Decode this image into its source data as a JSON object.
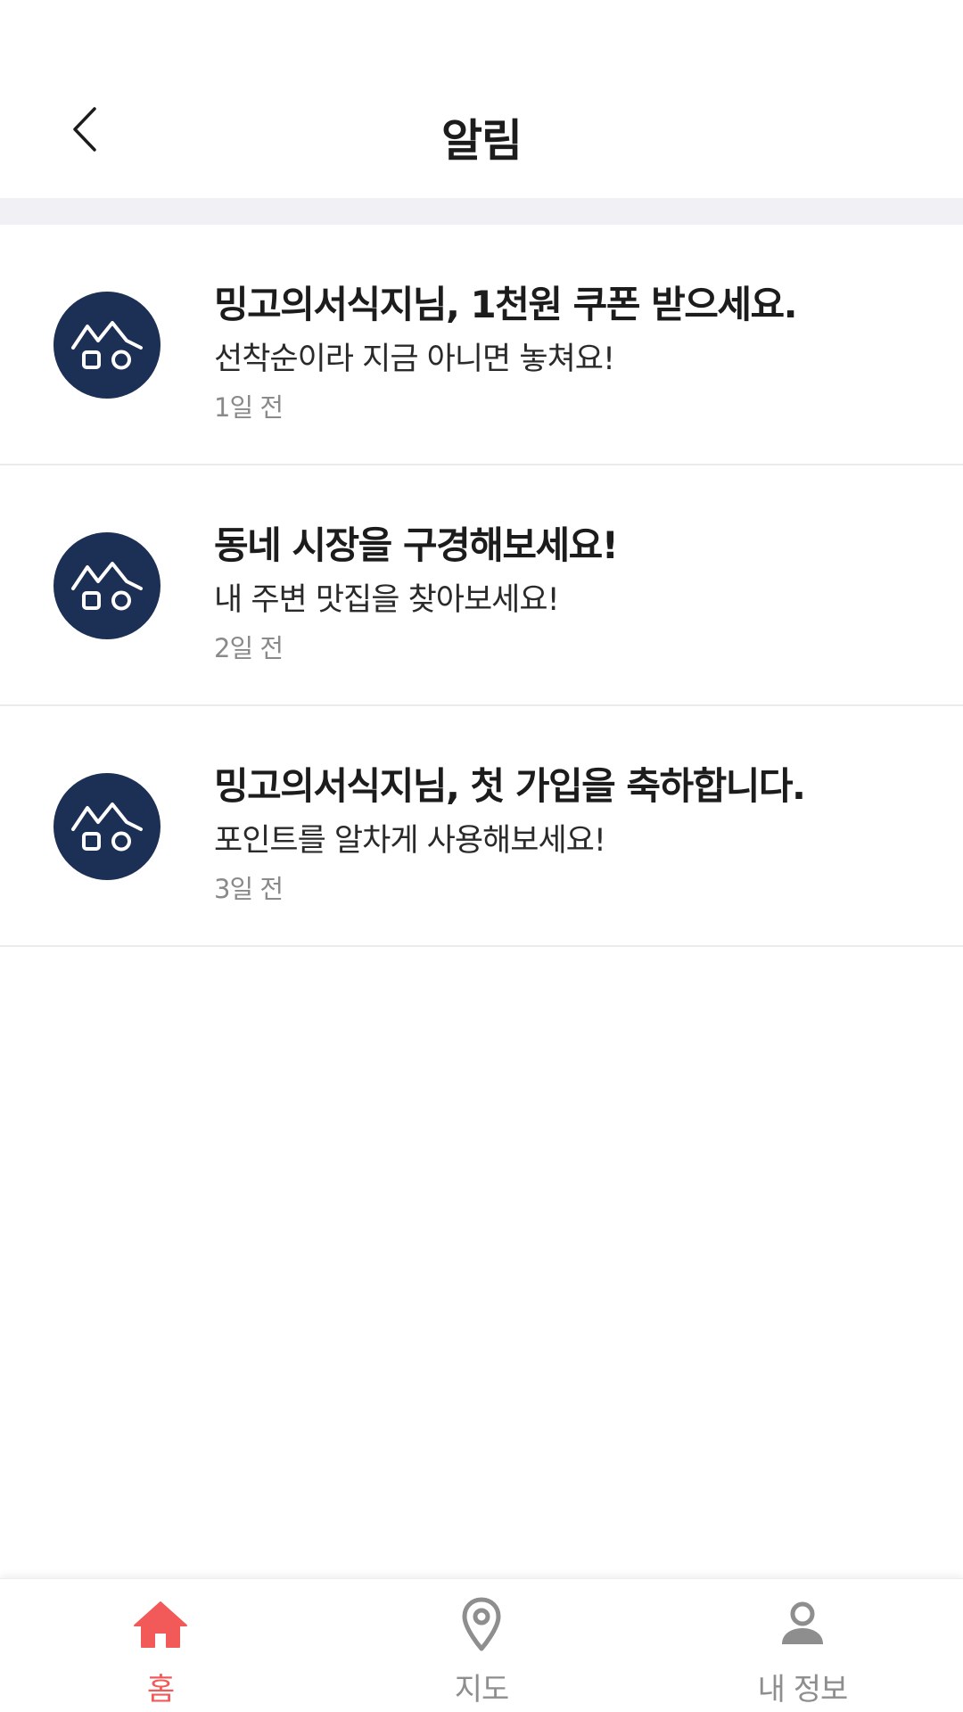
{
  "header": {
    "title": "알림",
    "back_icon": "chevron-left-icon"
  },
  "notifications": [
    {
      "title": "밍고의서식지님, 1천원 쿠폰 받으세요.",
      "body": "선착순이라 지금 아니면 놓쳐요!",
      "time": "1일 전",
      "icon": "mingo-logo-icon"
    },
    {
      "title": "동네 시장을 구경해보세요!",
      "body": "내 주변 맛집을 찾아보세요!",
      "time": "2일 전",
      "icon": "mingo-logo-icon"
    },
    {
      "title": "밍고의서식지님, 첫 가입을 축하합니다.",
      "body": "포인트를 알차게 사용해보세요!",
      "time": "3일 전",
      "icon": "mingo-logo-icon"
    }
  ],
  "bottom_nav": {
    "items": [
      {
        "label": "홈",
        "icon": "home-icon",
        "active": true
      },
      {
        "label": "지도",
        "icon": "map-pin-icon",
        "active": false
      },
      {
        "label": "내 정보",
        "icon": "user-icon",
        "active": false
      }
    ]
  },
  "colors": {
    "accent": "#f25a5a",
    "avatar_bg": "#1c2f55",
    "inactive": "#8e8e8e",
    "divider_band": "#f1f1f5"
  }
}
